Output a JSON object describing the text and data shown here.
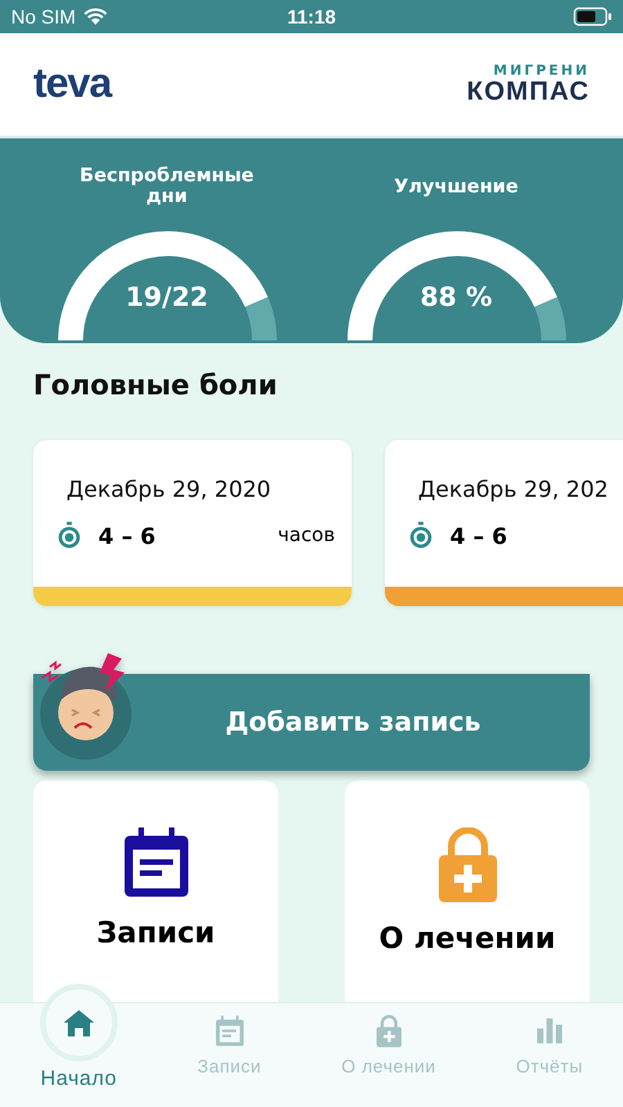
{
  "status_bar": {
    "carrier": "No SIM",
    "time": "11:18"
  },
  "header": {
    "brand_left": "teva",
    "brand_right_top": "МИГРЕНИ",
    "brand_right_main": "КОМПАС"
  },
  "stats": [
    {
      "label": "Беспроблемные дни",
      "value": "19/22"
    },
    {
      "label": "Улучшение",
      "value": "88 %"
    }
  ],
  "headaches": {
    "title": "Головные боли",
    "cards": [
      {
        "date": "Декабрь 29, 2020",
        "range": "4 – 6",
        "unit": "часов",
        "color": "#f5cb45"
      },
      {
        "date": "Декабрь 29, 202",
        "range": "4 – 6",
        "color": "#f0a035"
      }
    ]
  },
  "add_button": "Добавить запись",
  "tiles": [
    {
      "kind": "records",
      "label": "Записи"
    },
    {
      "kind": "treatment",
      "label": "О лечении"
    }
  ],
  "tabs": [
    {
      "kind": "home",
      "label": "Начало",
      "selected": true
    },
    {
      "kind": "records",
      "label": "Записи",
      "selected": false
    },
    {
      "kind": "treatment",
      "label": "О лечении",
      "selected": false
    },
    {
      "kind": "reports",
      "label": "Отчёты",
      "selected": false
    }
  ]
}
